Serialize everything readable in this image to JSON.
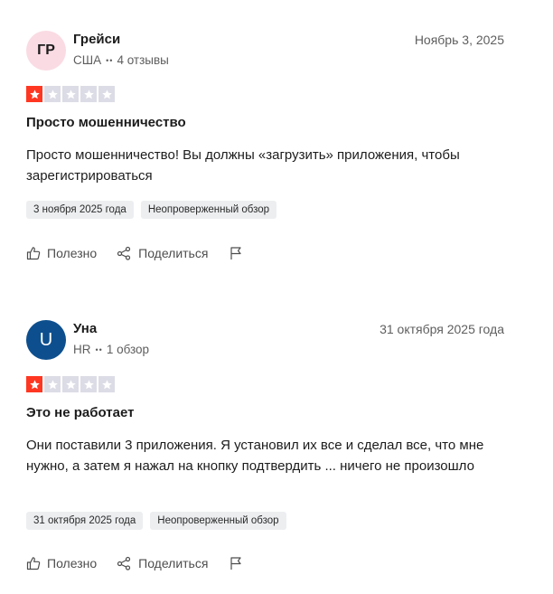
{
  "reviews": [
    {
      "avatar_initials": "ГР",
      "avatar_bg": "#fadbe3",
      "avatar_fg": "#1c1c1c",
      "name": "Грейси",
      "country": "США",
      "review_count": "4 отзывы",
      "date": "Ноябрь 3, 2025",
      "rating": 1,
      "title": "Просто мошенничество",
      "body": "Просто мошенничество! Вы должны «загрузить» приложения, чтобы зарегистрироваться",
      "tags": [
        "3 ноября 2025 года",
        "Неопроверженный обзор"
      ],
      "useful_label": "Полезно",
      "share_label": "Поделиться"
    },
    {
      "avatar_initials": "U",
      "avatar_bg": "#0d4f8e",
      "avatar_fg": "#ffffff",
      "name": "Уна",
      "country": "HR",
      "review_count": "1 обзор",
      "date": "31 октября 2025 года",
      "rating": 1,
      "title": "Это не работает",
      "body": "Они поставили 3 приложения. Я установил их все и сделал все, что мне нужно, а затем я нажал на кнопку подтвердить ... ничего не произошло",
      "tags": [
        "31 октября 2025 года",
        "Неопроверженный обзор"
      ],
      "useful_label": "Полезно",
      "share_label": "Поделиться"
    }
  ],
  "colors": {
    "star_filled": "#ff3722",
    "star_empty": "#dcdce6"
  },
  "icons": [
    "thumbs-up-icon",
    "share-icon",
    "flag-icon",
    "star-icon"
  ]
}
